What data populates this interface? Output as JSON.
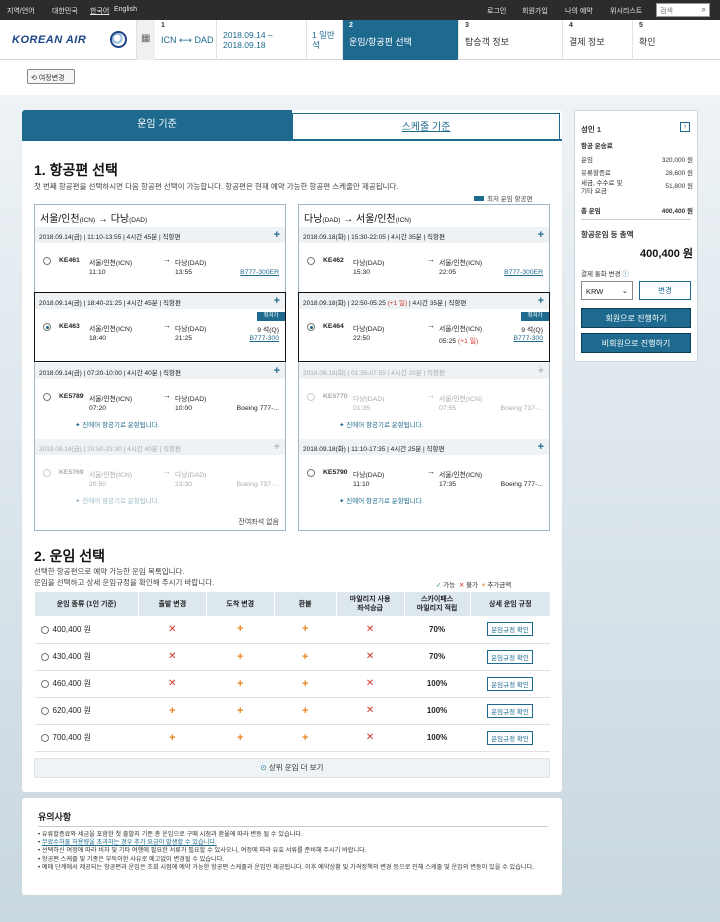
{
  "util": {
    "region": "지역/언어",
    "country": "대한민국",
    "lang_ko": "한국어",
    "lang_en": "English",
    "login": "로그인",
    "signup": "회원가입",
    "myres": "나의 예약",
    "wish": "위시리스트",
    "search_ph": "검색"
  },
  "header": {
    "logo": "KOREAN AIR",
    "route_from": "ICN",
    "route_to": "DAD",
    "dates": "2018.09.14 –\n2018.09.18",
    "trip": "1 일반\n석",
    "steps": [
      {
        "num": "2",
        "label": "운임/항공편 선택"
      },
      {
        "num": "3",
        "label": "탑승객 정보"
      },
      {
        "num": "4",
        "label": "결제 정보"
      },
      {
        "num": "5",
        "label": "확인"
      }
    ],
    "step1_num": "1"
  },
  "edit_button": "여정변경",
  "tabs": {
    "fare": "운임 기준",
    "schedule": "스케줄 기준"
  },
  "section1": {
    "title": "1. 항공편 선택",
    "desc": "첫 번째 항공편을 선택하시면 다음 항공편 선택이 가능합니다. 항공편은 현재 예약 가능한 항공편 스케줄만 제공됩니다.",
    "cheap_legend": "최저 운임 항공편"
  },
  "outbound": {
    "from": "서울/인천",
    "from_code": "(ICN)",
    "to": "다낭",
    "to_code": "(DAD)",
    "flights": [
      {
        "bar": "2018.09.14(금)  |  11:10-13:55  |  4시간 45분  |  직항편",
        "no": "KE461",
        "dep": "서울/인천(ICN)",
        "dep_t": "11:10",
        "arr": "다낭(DAD)",
        "arr_t": "13:55",
        "aircraft": "B777-300ER"
      },
      {
        "bar": "2018.09.14(금)  |  18:40-21:25  |  4시간 45분  |  직항편",
        "no": "KE463",
        "dep": "서울/인천(ICN)",
        "dep_t": "18:40",
        "arr": "다낭(DAD)",
        "arr_t": "21:25",
        "seats": "9 석(Q)",
        "aircraft": "B777-300",
        "badge": "최저가"
      },
      {
        "bar": "2018.09.14(금)  |  07:20-10:00  |  4시간 40분  |  직항편",
        "no": "KE5789",
        "dep": "서울/인천(ICN)",
        "dep_t": "07:20",
        "arr": "다낭(DAD)",
        "arr_t": "10:00",
        "aircraft": "Boeing 777-...",
        "airline": "진에어 항공기로 운항됩니다."
      },
      {
        "bar": "2018.09.14(금)  |  20:50-23:30  |  4시간 40분  |  직항편",
        "no": "KE5769",
        "dep": "서울/인천(ICN)",
        "dep_t": "20:50",
        "arr": "다낭(DAD)",
        "arr_t": "23:30",
        "aircraft": "Boeing 737-...",
        "airline": "진에어 항공기로 운항됩니다.",
        "note": "잔여좌석 없음"
      }
    ]
  },
  "inbound": {
    "from": "다낭",
    "from_code": "(DAD)",
    "to": "서울/인천",
    "to_code": "(ICN)",
    "flights": [
      {
        "bar": "2018.09.18(화)  |  15:30-22:05  |  4시간 35분  |  직항편",
        "no": "KE462",
        "dep": "다낭(DAD)",
        "dep_t": "15:30",
        "arr": "서울/인천(ICN)",
        "arr_t": "22:05",
        "aircraft": "B777-300ER"
      },
      {
        "bar": "2018.09.18(화)  |  22:50-05:25",
        "plus1": "(+1 일)",
        "bar2": "|  4시간 35분  |  직항편",
        "no": "KE464",
        "dep": "다낭(DAD)",
        "dep_t": "22:50",
        "arr": "서울/인천(ICN)",
        "arr_t": "05:25",
        "arr_plus": "(+1 일)",
        "seats": "9 석(Q)",
        "aircraft": "B777-300",
        "badge": "최저가"
      },
      {
        "bar": "2018.09.18(화)  |  01:35-07:55  |  4시간 20분  |  직항편",
        "no": "KE5770",
        "dep": "다낭(DAD)",
        "dep_t": "01:35",
        "arr": "서울/인천(ICN)",
        "arr_t": "07:55",
        "aircraft": "Boeing 737-...",
        "airline": "진에어 항공기로 운항됩니다."
      },
      {
        "bar": "2018.09.18(화)  |  11:10-17:35  |  4시간 25분  |  직항편",
        "no": "KE5790",
        "dep": "다낭(DAD)",
        "dep_t": "11:10",
        "arr": "서울/인천(ICN)",
        "arr_t": "17:35",
        "aircraft": "Boeing 777-...",
        "airline": "진에어 항공기로 운항됩니다."
      }
    ]
  },
  "section2": {
    "title": "2. 운임 선택",
    "desc1": "선택한 항공편으로 예약 가능한 운임 목록입니다.",
    "desc2": "운임을 선택하고 상세 운임규정을 확인해 주시기 바랍니다.",
    "leg_ok": "가능",
    "leg_no": "불가",
    "leg_fee": "추가금액",
    "headers": [
      "운임 종류 (1인 기준)",
      "출발 변경",
      "도착 변경",
      "환불",
      "마일리지 사용\n좌석승급",
      "스카이패스\n마일리지 적립",
      "상세 운임 규정"
    ],
    "rows": [
      {
        "price": "400,400 원",
        "c": [
          "x",
          "+",
          "+",
          "x"
        ],
        "mile": "70%",
        "rule": "운임규정 확인"
      },
      {
        "price": "430,400 원",
        "c": [
          "x",
          "+",
          "+",
          "x"
        ],
        "mile": "70%",
        "rule": "운임규정 확인"
      },
      {
        "price": "460,400 원",
        "c": [
          "x",
          "+",
          "+",
          "x"
        ],
        "mile": "100%",
        "rule": "운임규정 확인"
      },
      {
        "price": "620,400 원",
        "c": [
          "+",
          "+",
          "+",
          "x"
        ],
        "mile": "100%",
        "rule": "운임규정 확인"
      },
      {
        "price": "700,400 원",
        "c": [
          "+",
          "+",
          "+",
          "x"
        ],
        "mile": "100%",
        "rule": "운임규정 확인"
      }
    ],
    "more": "상위 운임 더 보기"
  },
  "notice": {
    "title": "유의사항",
    "items": [
      "유류할증료와 세금을 포함한 첫 출발지 기준 총 운임으로 구매 시점과 환율에 따라 변동 될 수 있습니다.",
      "무료수하물 허용량을 초과하는 경우 추가 요금이 발생할 수 있습니다.",
      "선택하신 여정에 따라 비자 및 기타 여행에 필요한 서류가 필요할 수 있사오니, 여정에 따라 유효 서류를 준비해 주시기 바랍니다.",
      "항공편 스케줄 및 기종은 부득이한 사유로 예고없이 변경될 수 있습니다.",
      "예매 단계에서 제공되는 항공편과 운임은 조회 시점에 예약 가능한 항공편 스케줄과 운임만 제공됩니다. 이후 예약상황 및 가격정책의 변경 등으로 인해 스케줄 및 운임의 변동이 있을 수 있습니다."
    ]
  },
  "summary": {
    "adult": "성인 1",
    "fare_title": "항공 운송료",
    "fare_label": "운임",
    "fare": "320,000 원",
    "fuel_label": "유류할증료",
    "fuel": "28,600 원",
    "tax_label": "세금, 수수료 및\n기타 요금",
    "tax": "51,800 원",
    "total_label": "총 운임",
    "total": "400,400 원",
    "grand_label": "항공운임 등 총액",
    "grand": "400,400 원",
    "currency_label": "결제 통화 변경",
    "currency": "KRW",
    "change": "변경",
    "member": "회원으로 진행하기",
    "nonmember": "비회원으로 진행하기"
  }
}
